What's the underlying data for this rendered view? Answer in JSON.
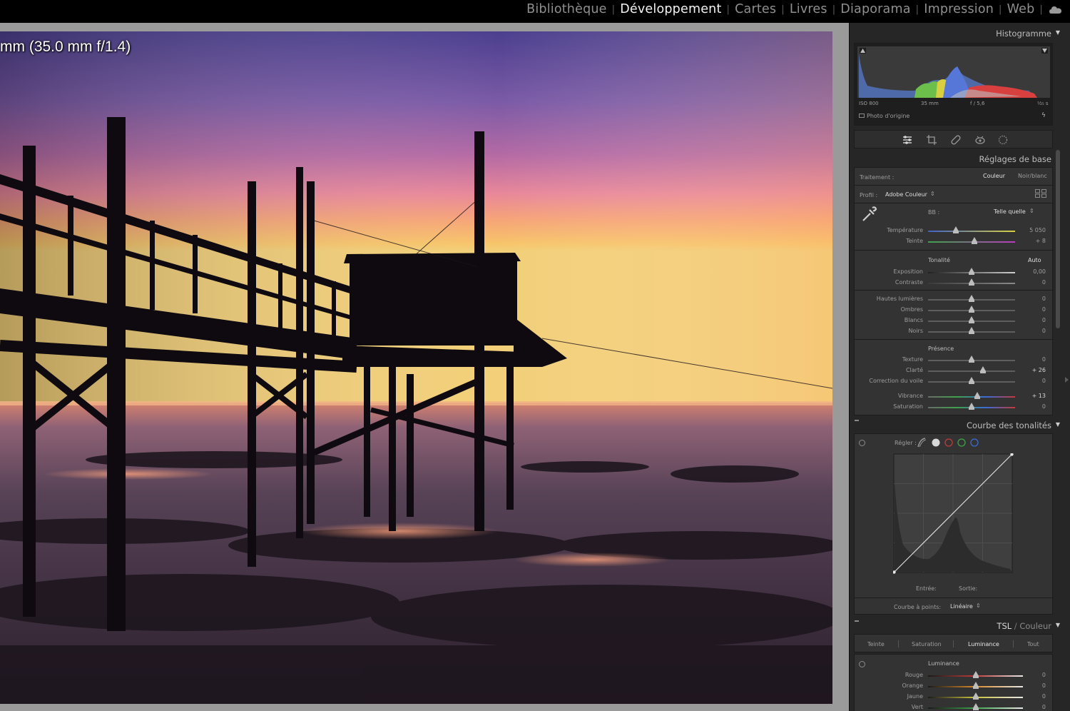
{
  "modules": [
    "Bibliothèque",
    "Développement",
    "Cartes",
    "Livres",
    "Diaporama",
    "Impression",
    "Web"
  ],
  "active_module": "Développement",
  "photo": {
    "info_overlay": "mm (35.0 mm f/1.4)"
  },
  "histogram": {
    "title": "Histogramme",
    "iso": "ISO 800",
    "focal": "35 mm",
    "aperture": "f / 5,6",
    "shutter": "¹⁄₂₅ s",
    "original_photo": "Photo d'origine"
  },
  "tools": [
    "sliders-icon",
    "crop-icon",
    "heal-icon",
    "redeye-icon",
    "mask-icon"
  ],
  "basic": {
    "title": "Réglages de base",
    "treatment_label": "Traitement :",
    "color": "Couleur",
    "bw": "Noir/blanc",
    "profile_label": "Profil :",
    "profile_value": "Adobe Couleur",
    "wb_label": "BB :",
    "wb_value": "Telle quelle",
    "temperature": {
      "label": "Température",
      "value": "5 050",
      "position": 0.32
    },
    "tint": {
      "label": "Teinte",
      "value": "+ 8",
      "position": 0.53
    },
    "tone_label": "Tonalité",
    "auto": "Auto",
    "exposure": {
      "label": "Exposition",
      "value": "0,00",
      "position": 0.5
    },
    "contrast": {
      "label": "Contraste",
      "value": "0",
      "position": 0.5
    },
    "highlights": {
      "label": "Hautes lumières",
      "value": "0",
      "position": 0.5
    },
    "shadows": {
      "label": "Ombres",
      "value": "0",
      "position": 0.5
    },
    "whites": {
      "label": "Blancs",
      "value": "0",
      "position": 0.5
    },
    "blacks": {
      "label": "Noirs",
      "value": "0",
      "position": 0.5
    },
    "presence_label": "Présence",
    "texture": {
      "label": "Texture",
      "value": "0",
      "position": 0.5
    },
    "clarity": {
      "label": "Clarté",
      "value": "+ 26",
      "position": 0.63
    },
    "dehaze": {
      "label": "Correction du voile",
      "value": "0",
      "position": 0.5
    },
    "vibrance": {
      "label": "Vibrance",
      "value": "+ 13",
      "position": 0.565
    },
    "saturation": {
      "label": "Saturation",
      "value": "0",
      "position": 0.5
    }
  },
  "tone_curve": {
    "title": "Courbe des tonalités",
    "adjust_label": "Régler :",
    "input_label": "Entrée:",
    "output_label": "Sortie:",
    "point_curve_label": "Courbe à points:",
    "point_curve_value": "Linéaire"
  },
  "hsl": {
    "title_a": "TSL",
    "title_b": "Couleur",
    "tabs": [
      "Teinte",
      "Saturation",
      "Luminance",
      "Tout"
    ],
    "active_tab": "Luminance",
    "section_label": "Luminance",
    "rows": [
      {
        "label": "Rouge",
        "value": "0",
        "position": 0.5,
        "color": "#c23b3b"
      },
      {
        "label": "Orange",
        "value": "0",
        "position": 0.5,
        "color": "#d88a2a"
      },
      {
        "label": "Jaune",
        "value": "0",
        "position": 0.5,
        "color": "#c9c23a"
      },
      {
        "label": "Vert",
        "value": "0",
        "position": 0.5,
        "color": "#3ea34a"
      }
    ]
  },
  "colors": {
    "panel_bg": "#262626",
    "section_bg": "#333333",
    "active_text": "#f2f2f2"
  }
}
